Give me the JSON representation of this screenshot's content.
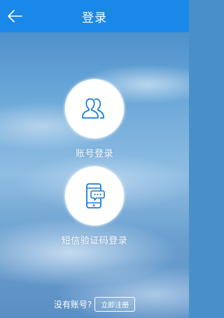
{
  "header": {
    "title": "登录",
    "back_icon": "arrow-left-icon",
    "background_color": "#1a88e8"
  },
  "options": {
    "account_login": {
      "label": "账号登录",
      "icon": "user-icon"
    },
    "sms_login": {
      "label": "短信验证码登录",
      "icon": "phone-message-icon"
    }
  },
  "footer": {
    "prompt": "没有账号?",
    "register_label": "立即注册"
  },
  "colors": {
    "accent": "#1a88e8",
    "icon_blue": "#1a7fd8"
  }
}
